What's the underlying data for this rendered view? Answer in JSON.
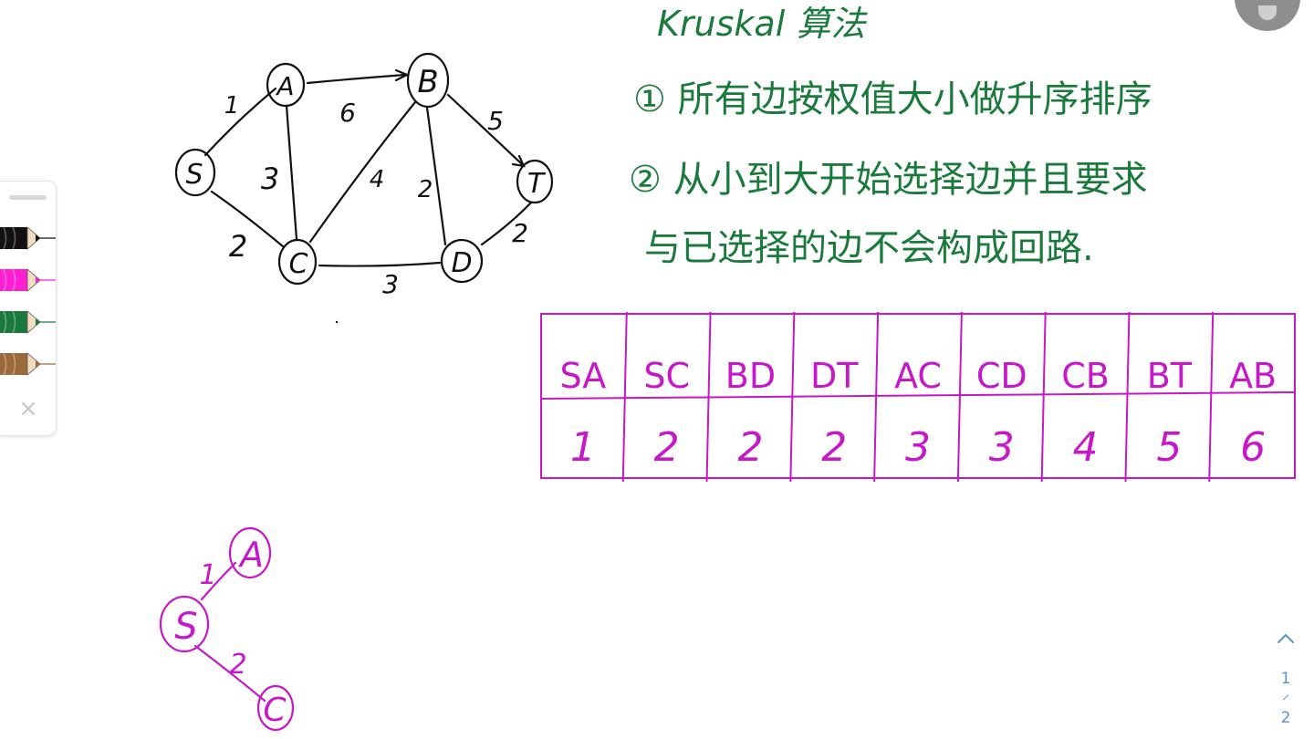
{
  "graph": {
    "nodes": [
      {
        "id": "S",
        "label": "S"
      },
      {
        "id": "A",
        "label": "A"
      },
      {
        "id": "B",
        "label": "B"
      },
      {
        "id": "C",
        "label": "C"
      },
      {
        "id": "D",
        "label": "D"
      },
      {
        "id": "T",
        "label": "T"
      }
    ],
    "edges": [
      {
        "from": "S",
        "to": "A",
        "weight": "1"
      },
      {
        "from": "S",
        "to": "C",
        "weight": "2"
      },
      {
        "from": "A",
        "to": "C",
        "weight": "3"
      },
      {
        "from": "A",
        "to": "B",
        "weight": "6"
      },
      {
        "from": "C",
        "to": "B",
        "weight": "4"
      },
      {
        "from": "C",
        "to": "D",
        "weight": "3"
      },
      {
        "from": "B",
        "to": "D",
        "weight": "2"
      },
      {
        "from": "B",
        "to": "T",
        "weight": "5"
      },
      {
        "from": "D",
        "to": "T",
        "weight": "2"
      }
    ]
  },
  "notes": {
    "title": "Kruskal 算法",
    "step1": "① 所有边按权值大小做升序排序",
    "step2_line1": "② 从小到大开始选择边并且要求",
    "step2_line2": "与已选择的边不会构成回路."
  },
  "edge_table": {
    "headers": [
      "SA",
      "SC",
      "BD",
      "DT",
      "AC",
      "CD",
      "CB",
      "BT",
      "AB"
    ],
    "values": [
      "1",
      "2",
      "2",
      "2",
      "3",
      "3",
      "4",
      "5",
      "6"
    ]
  },
  "mst_progress": {
    "nodes": [
      {
        "id": "A",
        "label": "A"
      },
      {
        "id": "S",
        "label": "S"
      },
      {
        "id": "C",
        "label": "C"
      }
    ],
    "edges": [
      {
        "from": "S",
        "to": "A",
        "weight": "1"
      },
      {
        "from": "S",
        "to": "C",
        "weight": "2"
      }
    ]
  },
  "toolbar": {
    "pens": [
      {
        "name": "black-pen",
        "color": "#111111"
      },
      {
        "name": "magenta-pen",
        "color": "#ff1fd2"
      },
      {
        "name": "green-pen",
        "color": "#1a7a3c"
      },
      {
        "name": "brown-pen",
        "color": "#9a6a3a"
      }
    ],
    "close_icon": "×"
  },
  "pagination": {
    "current": "1",
    "total": "2"
  },
  "colors": {
    "ink_black": "#111111",
    "ink_green": "#1a7a3c",
    "ink_magenta": "#c617c8",
    "nav_blue": "#5b93c9"
  }
}
